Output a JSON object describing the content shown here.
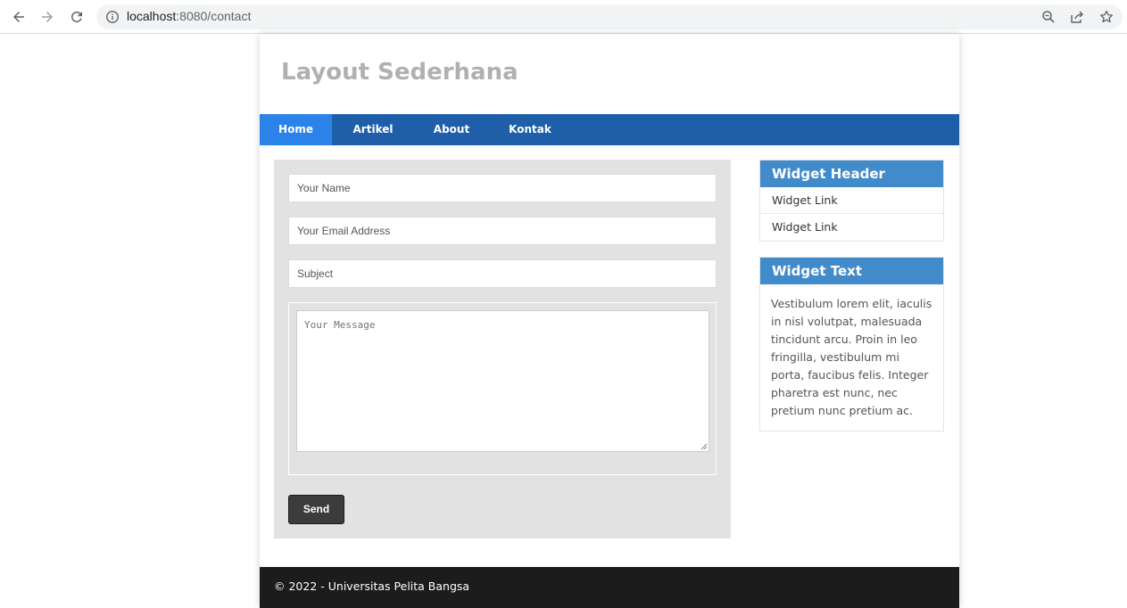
{
  "browser": {
    "url_host": "localhost",
    "url_path": ":8080/contact",
    "icons": [
      "back-arrow-icon",
      "forward-arrow-icon",
      "reload-icon",
      "site-info-icon",
      "zoom-icon",
      "share-icon",
      "bookmark-star-icon"
    ]
  },
  "site": {
    "title": "Layout Sederhana"
  },
  "nav": {
    "items": [
      {
        "label": "Home",
        "active": true
      },
      {
        "label": "Artikel",
        "active": false
      },
      {
        "label": "About",
        "active": false
      },
      {
        "label": "Kontak",
        "active": false
      }
    ]
  },
  "form": {
    "name_placeholder": "Your Name",
    "email_placeholder": "Your Email Address",
    "subject_placeholder": "Subject",
    "message_placeholder": "Your Message",
    "send_label": "Send"
  },
  "sidebar": {
    "widget1": {
      "header": "Widget Header",
      "links": [
        "Widget Link",
        "Widget Link"
      ]
    },
    "widget2": {
      "header": "Widget Text",
      "text": "Vestibulum lorem elit, iaculis in nisl volutpat, malesuada tincidunt arcu. Proin in leo fringilla, vestibulum mi porta, faucibus felis. Integer pharetra est nunc, nec pretium nunc pretium ac."
    }
  },
  "footer": {
    "text": "© 2022 - Universitas Pelita Bangsa"
  },
  "colors": {
    "nav_bg": "#1f5faa",
    "nav_active": "#2b83ea",
    "widget_header": "#428bca",
    "footer_bg": "#1c1c1c",
    "form_bg": "#e2e2e2"
  }
}
